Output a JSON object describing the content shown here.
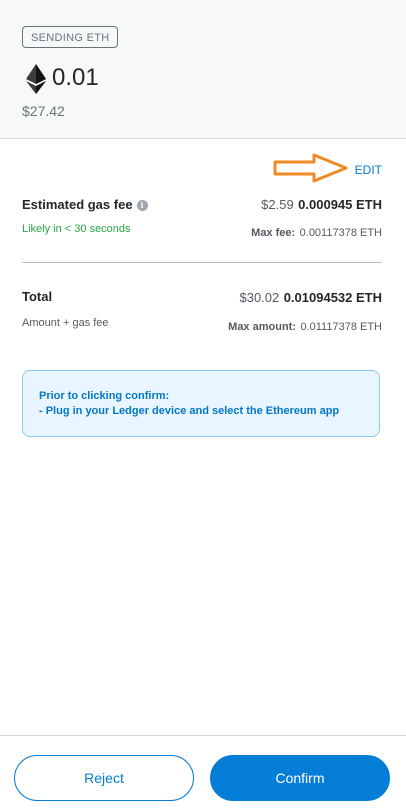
{
  "header": {
    "badge": "SENDING ETH",
    "amount": "0.01",
    "fiat": "$27.42"
  },
  "edit": {
    "label": "EDIT"
  },
  "gas": {
    "label": "Estimated gas fee",
    "info_icon": "info-icon",
    "fiat": "$2.59",
    "eth": "0.000945 ETH",
    "timing": "Likely in < 30 seconds",
    "max_label": "Max fee:",
    "max_value": "0.00117378 ETH"
  },
  "total": {
    "label": "Total",
    "fiat": "$30.02",
    "eth": "0.01094532 ETH",
    "sublabel": "Amount + gas fee",
    "max_label": "Max amount:",
    "max_value": "0.01117378 ETH"
  },
  "notice": {
    "line1": "Prior to clicking confirm:",
    "line2": "- Plug in your Ledger device and select the Ethereum app"
  },
  "footer": {
    "reject": "Reject",
    "confirm": "Confirm"
  },
  "colors": {
    "accent": "#037dd6",
    "success": "#28a745",
    "annotation_arrow": "#f08a24"
  }
}
